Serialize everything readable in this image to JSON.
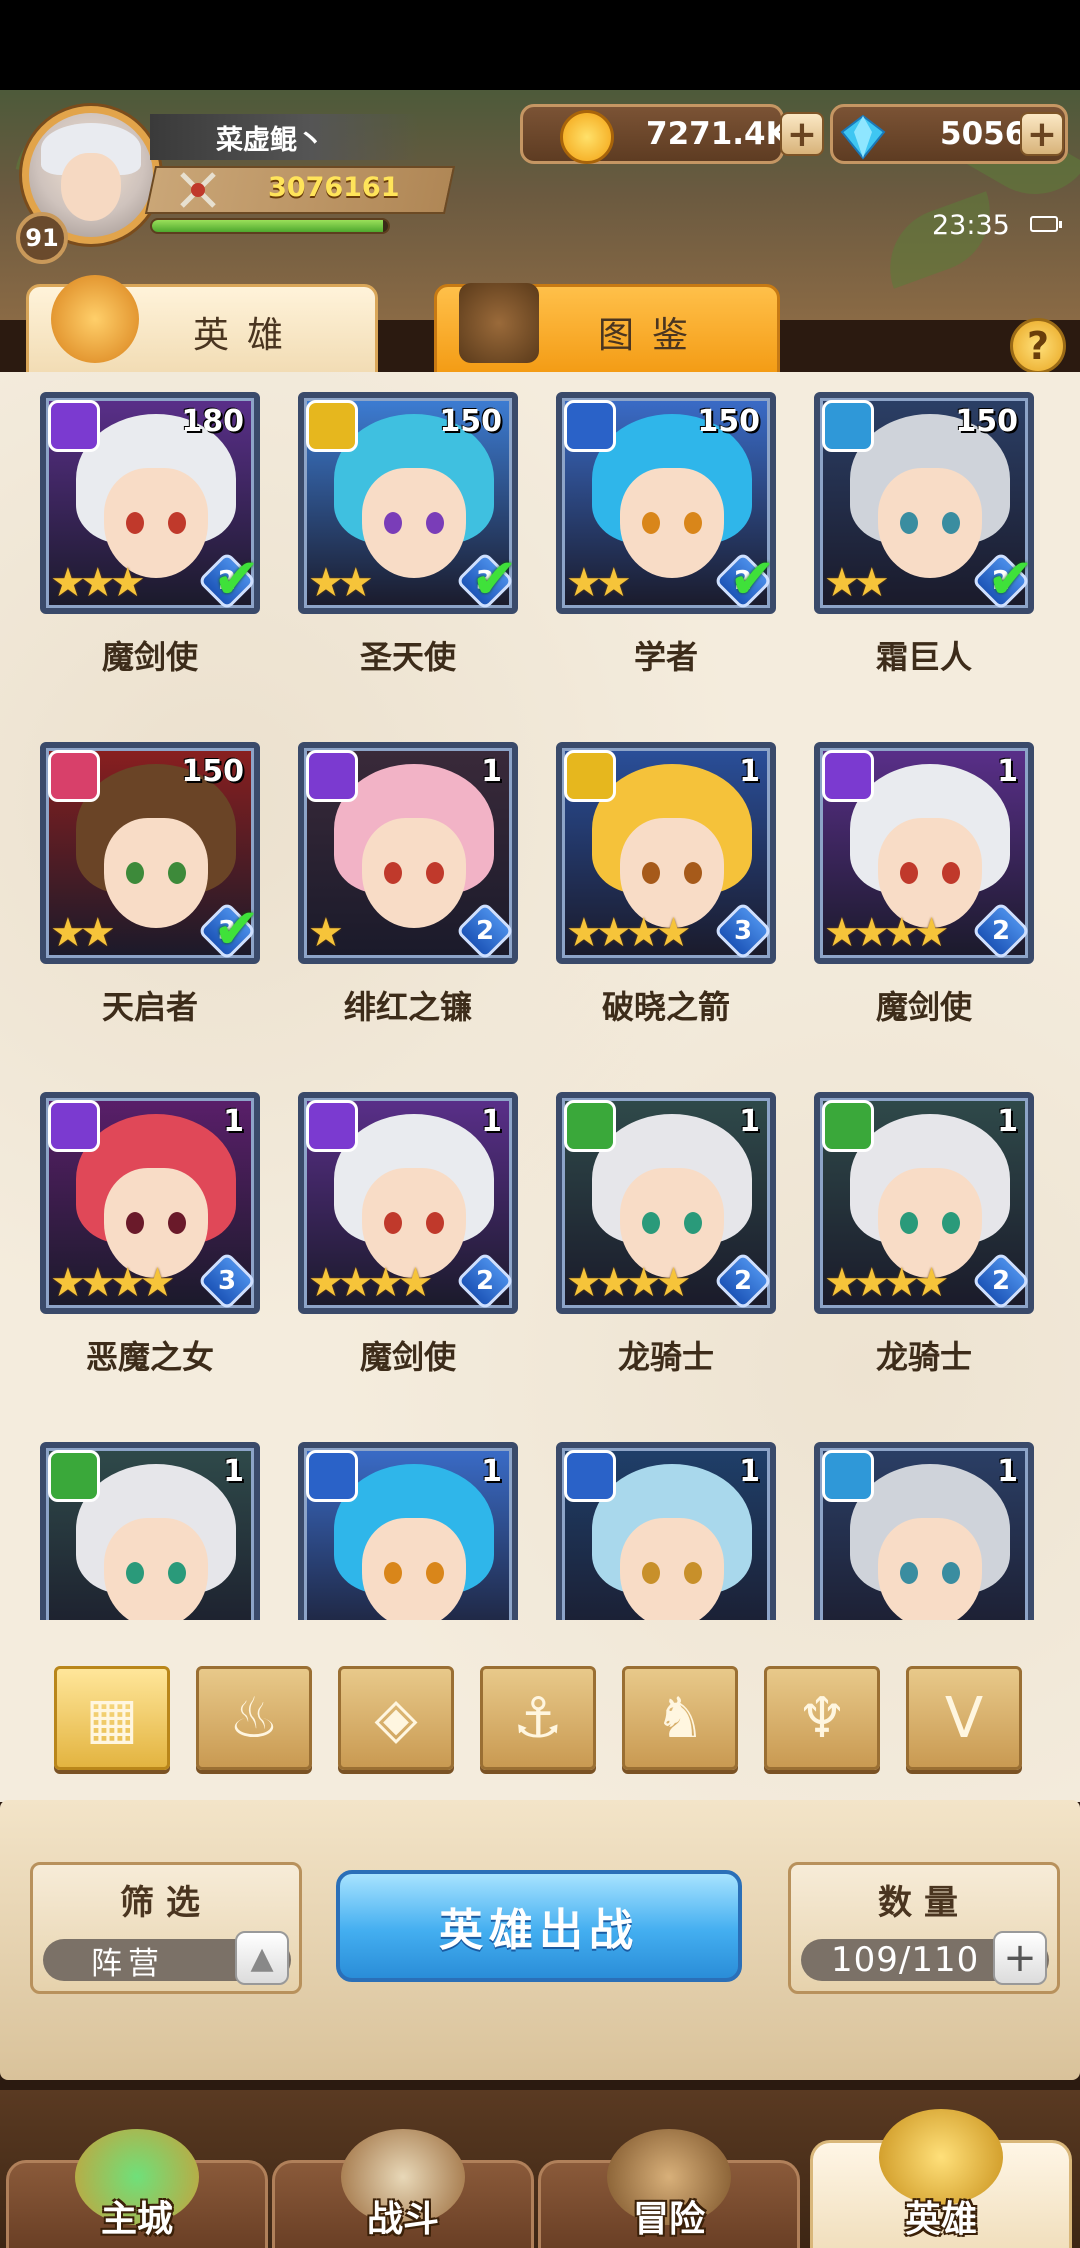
{
  "player": {
    "name": "菜虚鲲丶",
    "level": "91",
    "power": "3076161",
    "exp_fraction": 0.98
  },
  "currency": {
    "gold": "7271.4K",
    "gems": "5056"
  },
  "status": {
    "time": "23:35"
  },
  "tabs": {
    "heroes": "英雄",
    "atlas": "图鉴"
  },
  "help": "?",
  "heroes": [
    {
      "name": "魔剑使",
      "level": "180",
      "faction": "demon",
      "faction_color": "#7b3ad0",
      "stars": "★★★",
      "grade": "2",
      "checked": true,
      "hair": "#e9ebef",
      "bg": "#5a2f8a",
      "eye": "#c0392b"
    },
    {
      "name": "圣天使",
      "level": "150",
      "faction": "light",
      "faction_color": "#e6b71e",
      "stars": "★★",
      "grade": "3",
      "checked": true,
      "hair": "#3fc0e0",
      "bg": "#3d7dd4",
      "eye": "#7a3db8"
    },
    {
      "name": "学者",
      "level": "150",
      "faction": "ocean",
      "faction_color": "#2a62c8",
      "stars": "★★",
      "grade": "2",
      "checked": true,
      "hair": "#2fb6ea",
      "bg": "#3a6cc8",
      "eye": "#d9861a"
    },
    {
      "name": "霜巨人",
      "level": "150",
      "faction": "frost",
      "faction_color": "#2f98d8",
      "stars": "★★",
      "grade": "2",
      "checked": true,
      "hair": "#cfd3da",
      "bg": "#2b3f66",
      "eye": "#3a8da0"
    },
    {
      "name": "天启者",
      "level": "150",
      "faction": "flame",
      "faction_color": "#d8406a",
      "stars": "★★",
      "grade": "3",
      "checked": true,
      "hair": "#6a4426",
      "bg": "#8a1f1f",
      "eye": "#3d8a3a"
    },
    {
      "name": "绯红之镰",
      "level": "1",
      "faction": "demon",
      "faction_color": "#7b3ad0",
      "stars": "★",
      "grade": "2",
      "checked": false,
      "hair": "#f2b3c6",
      "bg": "#3a2a3a",
      "eye": "#c0392b"
    },
    {
      "name": "破晓之箭",
      "level": "1",
      "faction": "light",
      "faction_color": "#e6b71e",
      "stars": "★★★★",
      "grade": "3",
      "checked": false,
      "hair": "#f5c23a",
      "bg": "#2a4f9a",
      "eye": "#a65a1a"
    },
    {
      "name": "魔剑使",
      "level": "1",
      "faction": "demon",
      "faction_color": "#7b3ad0",
      "stars": "★★★★",
      "grade": "2",
      "checked": false,
      "hair": "#e9ebef",
      "bg": "#5a2f8a",
      "eye": "#c0392b"
    },
    {
      "name": "恶魔之女",
      "level": "1",
      "faction": "demon",
      "faction_color": "#7b3ad0",
      "stars": "★★★★",
      "grade": "3",
      "checked": false,
      "hair": "#e04858",
      "bg": "#5a1f6a",
      "eye": "#6a1a2a"
    },
    {
      "name": "魔剑使",
      "level": "1",
      "faction": "demon",
      "faction_color": "#7b3ad0",
      "stars": "★★★★",
      "grade": "2",
      "checked": false,
      "hair": "#e9ebef",
      "bg": "#5a2f8a",
      "eye": "#c0392b"
    },
    {
      "name": "龙骑士",
      "level": "1",
      "faction": "beast",
      "faction_color": "#3aa83a",
      "stars": "★★★★",
      "grade": "2",
      "checked": false,
      "hair": "#e6e6ea",
      "bg": "#2f4a4a",
      "eye": "#2a9a7a"
    },
    {
      "name": "龙骑士",
      "level": "1",
      "faction": "beast",
      "faction_color": "#3aa83a",
      "stars": "★★★★",
      "grade": "2",
      "checked": false,
      "hair": "#e6e6ea",
      "bg": "#2f4a4a",
      "eye": "#2a9a7a"
    },
    {
      "name": "",
      "level": "1",
      "faction": "beast",
      "faction_color": "#3aa83a",
      "stars": "",
      "grade": "",
      "checked": false,
      "hair": "#e6e6ea",
      "bg": "#2f4a4a",
      "eye": "#2a9a7a"
    },
    {
      "name": "",
      "level": "1",
      "faction": "ocean",
      "faction_color": "#2a62c8",
      "stars": "",
      "grade": "",
      "checked": false,
      "hair": "#2fb6ea",
      "bg": "#3a6cc8",
      "eye": "#d9861a"
    },
    {
      "name": "",
      "level": "1",
      "faction": "ocean",
      "faction_color": "#2a62c8",
      "stars": "",
      "grade": "",
      "checked": false,
      "hair": "#a9d8ec",
      "bg": "#1f3f6a",
      "eye": "#c8902a"
    },
    {
      "name": "",
      "level": "1",
      "faction": "frost",
      "faction_color": "#2f98d8",
      "stars": "",
      "grade": "",
      "checked": false,
      "hair": "#cfd3da",
      "bg": "#2b3f66",
      "eye": "#3a8da0"
    }
  ],
  "filters": [
    {
      "id": "all",
      "icon": "grid-icon",
      "glyph": "▦",
      "active": true
    },
    {
      "id": "flame",
      "icon": "flame-icon",
      "glyph": "♨",
      "active": false
    },
    {
      "id": "frost",
      "icon": "frost-icon",
      "glyph": "◈",
      "active": false
    },
    {
      "id": "ocean",
      "icon": "anchor-icon",
      "glyph": "⚓",
      "active": false
    },
    {
      "id": "beast",
      "icon": "beast-icon",
      "glyph": "♞",
      "active": false
    },
    {
      "id": "demon",
      "icon": "demon-icon",
      "glyph": "♆",
      "active": false
    },
    {
      "id": "light",
      "icon": "wings-icon",
      "glyph": "V",
      "active": false
    }
  ],
  "filter_box": {
    "title": "筛选",
    "value": "阵营"
  },
  "deploy_label": "英雄出战",
  "count_box": {
    "title": "数量",
    "value": "109/110"
  },
  "nav": [
    {
      "label": "主城",
      "icon": "castle-icon",
      "active": false
    },
    {
      "label": "战斗",
      "icon": "crossed-swords-icon",
      "active": false
    },
    {
      "label": "冒险",
      "icon": "scroll-map-icon",
      "active": false
    },
    {
      "label": "英雄",
      "icon": "helmet-icon",
      "active": true
    }
  ]
}
